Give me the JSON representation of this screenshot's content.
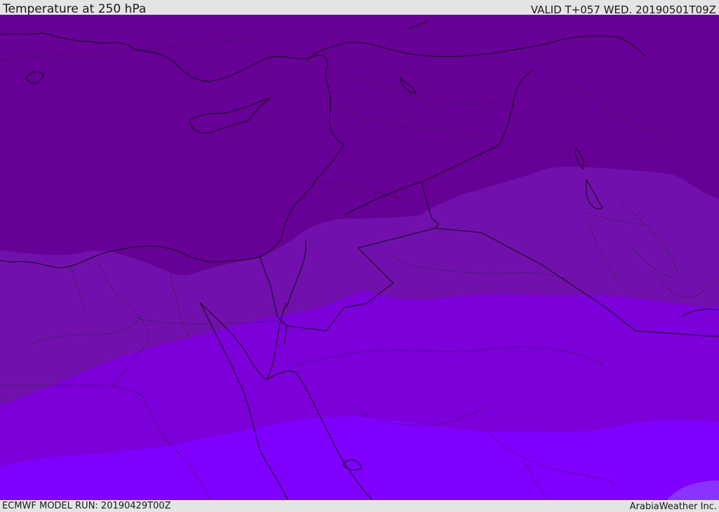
{
  "header": {
    "title": "Temperature at 250 hPa",
    "valid_time": "VALID T+057 WED. 20190501T09Z"
  },
  "footer": {
    "model_run": "ECMWF MODEL RUN: 20190429T00Z",
    "credit": "ArabiaWeather Inc."
  },
  "map": {
    "variable": "temperature",
    "level": "250 hPa",
    "colors": {
      "band_coldest": "#670096",
      "band_cold": "#7210ad",
      "band_mid": "#7c00d9",
      "band_warm": "#8000ff",
      "band_warmest_patch": "#8a33ff",
      "coastline": "#111111",
      "border": "#111111"
    }
  }
}
